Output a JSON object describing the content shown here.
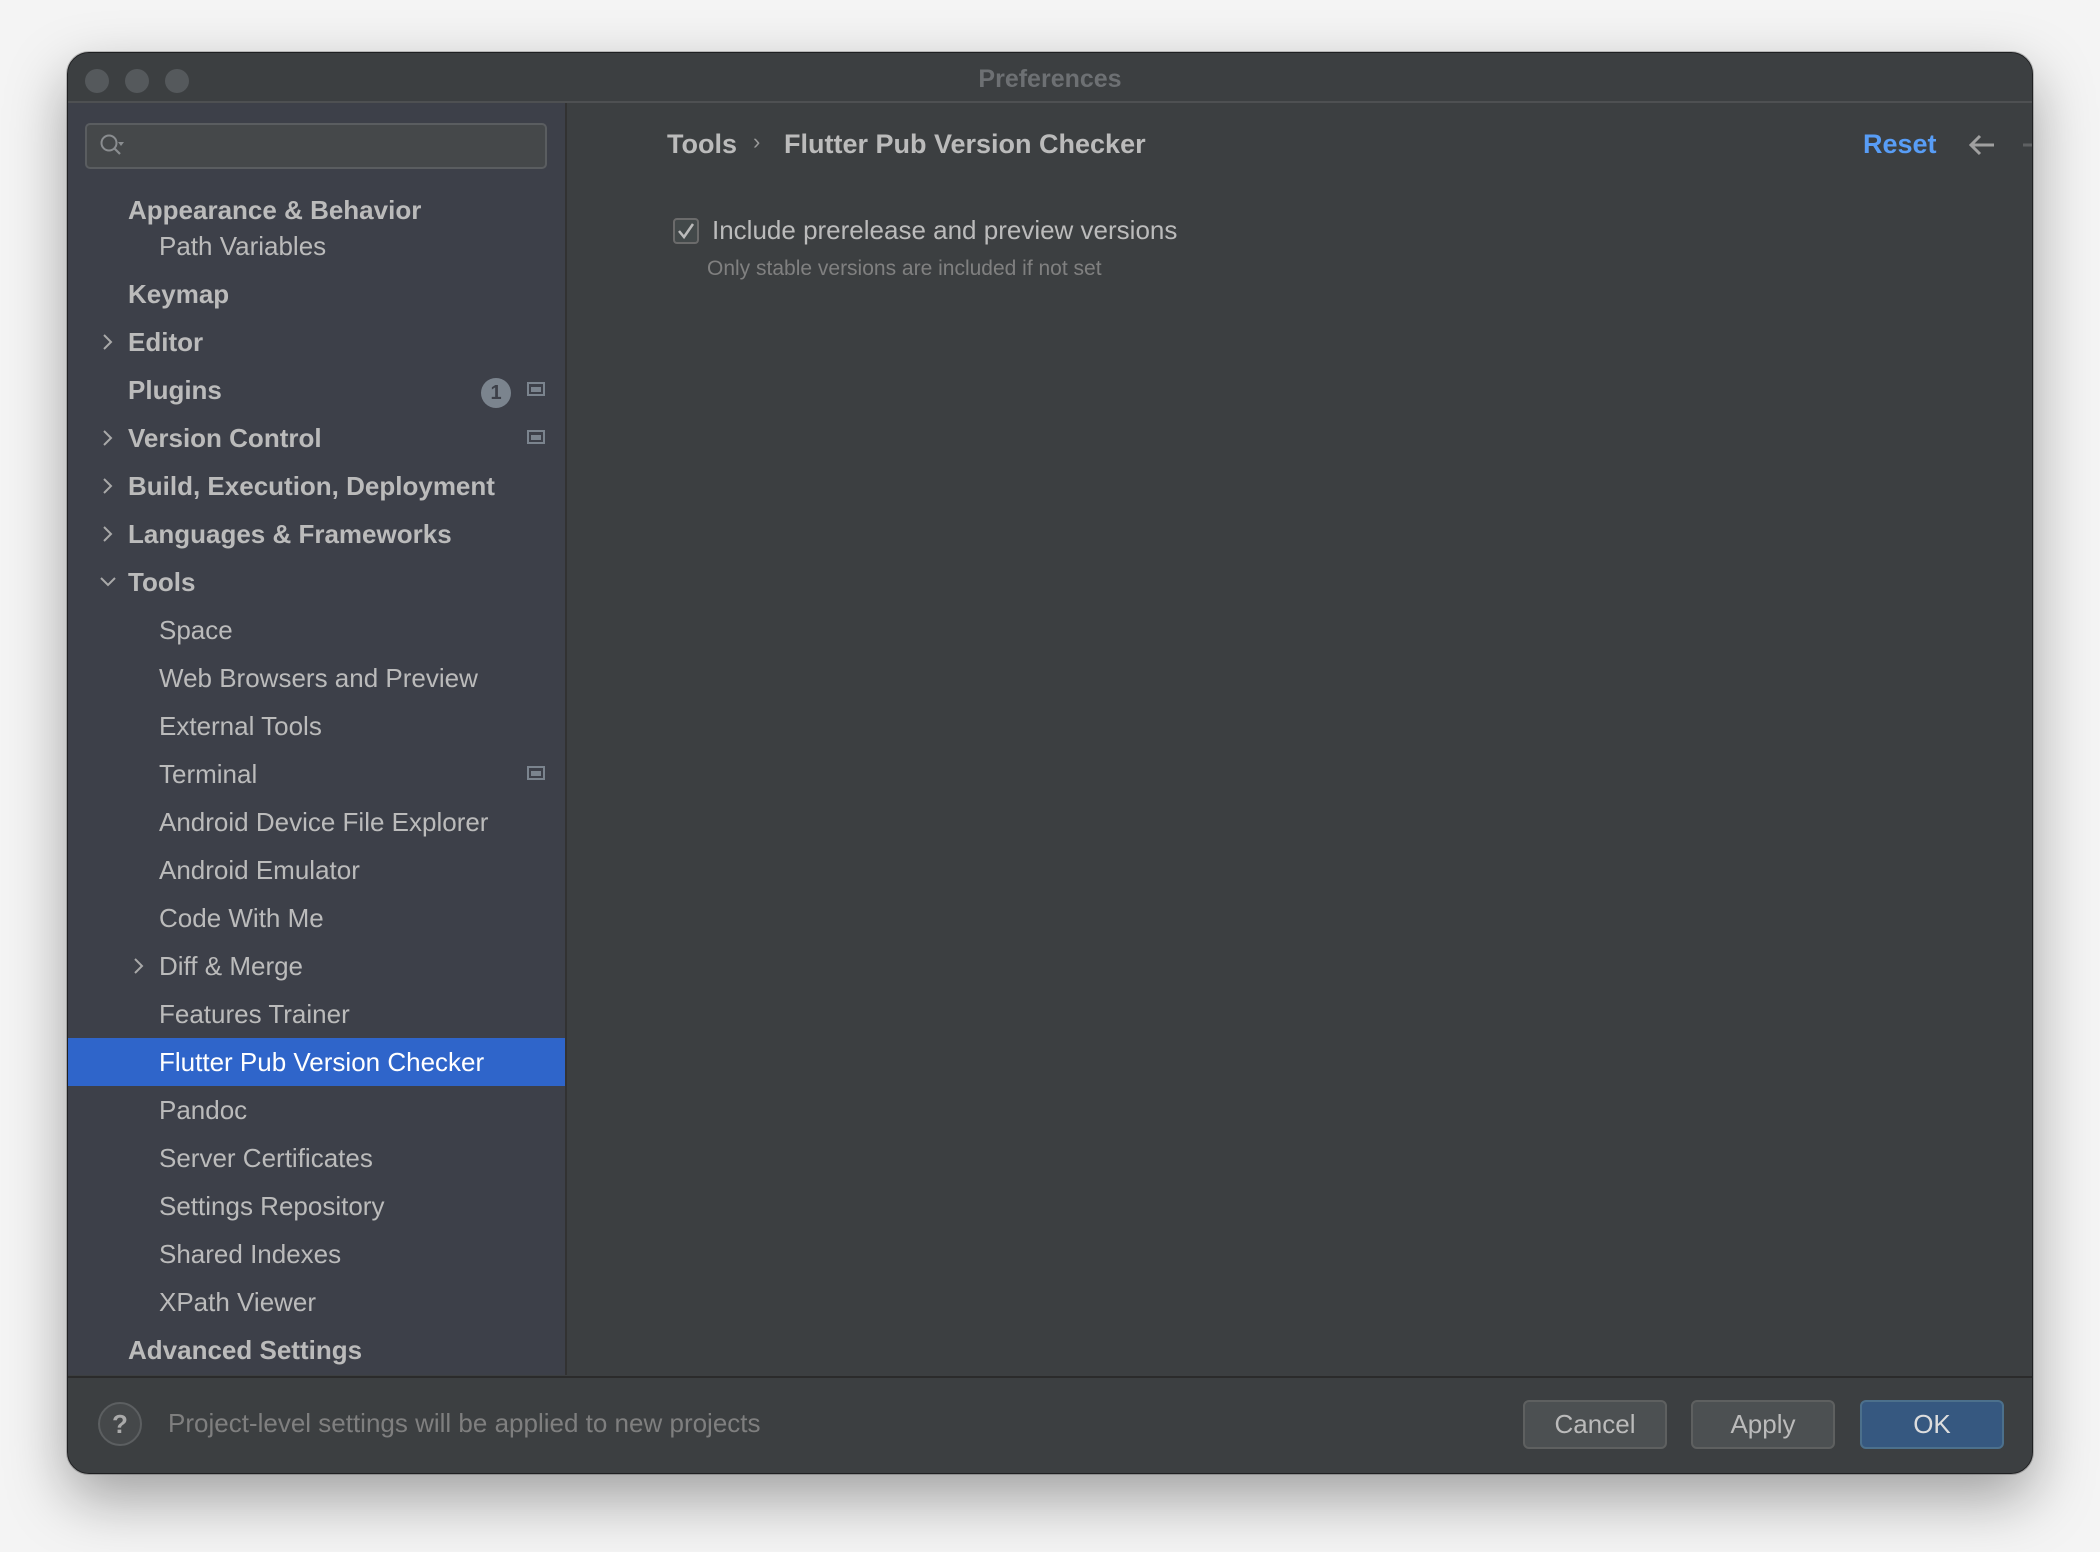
{
  "window": {
    "title": "Preferences",
    "traffic_lights": [
      "close",
      "minimize",
      "zoom"
    ]
  },
  "sidebar": {
    "search": {
      "placeholder": "",
      "value": "",
      "icon": "search-icon"
    },
    "items": [
      {
        "label": "Appearance & Behavior",
        "level": 0,
        "bold": true,
        "expander": "none"
      },
      {
        "label": "Path Variables",
        "level": 1,
        "bold": false,
        "expander": "none"
      },
      {
        "label": "Keymap",
        "level": 0,
        "bold": true,
        "expander": "none"
      },
      {
        "label": "Editor",
        "level": 0,
        "bold": true,
        "expander": "collapsed"
      },
      {
        "label": "Plugins",
        "level": 0,
        "bold": true,
        "expander": "none",
        "badge": "1",
        "project_icon": true
      },
      {
        "label": "Version Control",
        "level": 0,
        "bold": true,
        "expander": "collapsed",
        "project_icon": true
      },
      {
        "label": "Build, Execution, Deployment",
        "level": 0,
        "bold": true,
        "expander": "collapsed"
      },
      {
        "label": "Languages & Frameworks",
        "level": 0,
        "bold": true,
        "expander": "collapsed"
      },
      {
        "label": "Tools",
        "level": 0,
        "bold": true,
        "expander": "expanded"
      },
      {
        "label": "Space",
        "level": 1,
        "bold": false,
        "expander": "none"
      },
      {
        "label": "Web Browsers and Preview",
        "level": 1,
        "bold": false,
        "expander": "none"
      },
      {
        "label": "External Tools",
        "level": 1,
        "bold": false,
        "expander": "none"
      },
      {
        "label": "Terminal",
        "level": 1,
        "bold": false,
        "expander": "none",
        "project_icon": true
      },
      {
        "label": "Android Device File Explorer",
        "level": 1,
        "bold": false,
        "expander": "none"
      },
      {
        "label": "Android Emulator",
        "level": 1,
        "bold": false,
        "expander": "none"
      },
      {
        "label": "Code With Me",
        "level": 1,
        "bold": false,
        "expander": "none"
      },
      {
        "label": "Diff & Merge",
        "level": 1,
        "bold": false,
        "expander": "collapsed"
      },
      {
        "label": "Features Trainer",
        "level": 1,
        "bold": false,
        "expander": "none"
      },
      {
        "label": "Flutter Pub Version Checker",
        "level": 1,
        "bold": false,
        "expander": "none",
        "selected": true
      },
      {
        "label": "Pandoc",
        "level": 1,
        "bold": false,
        "expander": "none"
      },
      {
        "label": "Server Certificates",
        "level": 1,
        "bold": false,
        "expander": "none"
      },
      {
        "label": "Settings Repository",
        "level": 1,
        "bold": false,
        "expander": "none"
      },
      {
        "label": "Shared Indexes",
        "level": 1,
        "bold": false,
        "expander": "none"
      },
      {
        "label": "XPath Viewer",
        "level": 1,
        "bold": false,
        "expander": "none"
      },
      {
        "label": "Advanced Settings",
        "level": 0,
        "bold": true,
        "expander": "none"
      }
    ]
  },
  "content": {
    "breadcrumb": [
      "Tools",
      "Flutter Pub Version Checker"
    ],
    "breadcrumb_separator": "›",
    "reset_label": "Reset",
    "back_icon": "arrow-left-icon",
    "forward_icon": "arrow-right-icon",
    "option": {
      "label": "Include prerelease and preview versions",
      "checked": true,
      "hint": "Only stable versions are included if not set"
    }
  },
  "footer": {
    "help_label": "?",
    "text": "Project-level settings will be applied to new projects",
    "buttons": {
      "cancel": "Cancel",
      "apply": "Apply",
      "ok": "OK"
    }
  },
  "colors": {
    "accent": "#589df6",
    "selection": "#2f65ca",
    "primary_button": "#365880"
  }
}
